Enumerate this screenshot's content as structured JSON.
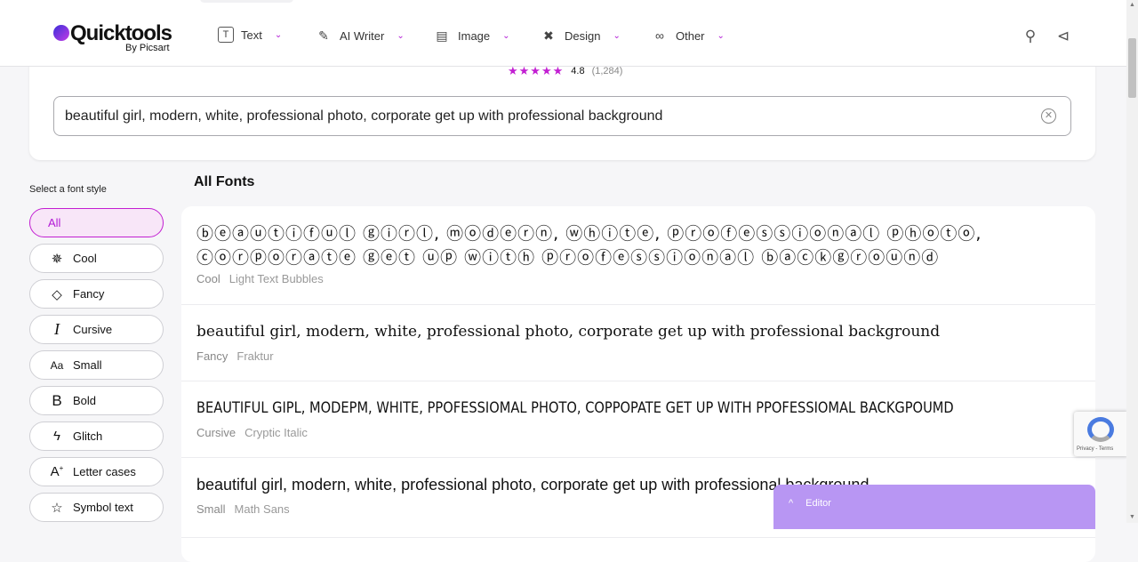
{
  "header": {
    "logo": "Quicktools",
    "logo_sub": "By Picsart",
    "nav": [
      {
        "label": "Text",
        "icon": "text-box-icon"
      },
      {
        "label": "AI Writer",
        "icon": "magic-wand-icon"
      },
      {
        "label": "Image",
        "icon": "image-icon"
      },
      {
        "label": "Design",
        "icon": "design-tools-icon"
      },
      {
        "label": "Other",
        "icon": "shapes-icon"
      }
    ],
    "accent": "#c21fd2"
  },
  "rating": {
    "value": "4.8",
    "count": "(1,284)",
    "stars": 5
  },
  "search": {
    "value": "beautiful girl, modern, white, professional photo, corporate get up with professional background"
  },
  "sidebar": {
    "label": "Select a font style",
    "items": [
      {
        "label": "All",
        "icon": ""
      },
      {
        "label": "Cool",
        "icon": "sparkle-icon"
      },
      {
        "label": "Fancy",
        "icon": "diamond-icon"
      },
      {
        "label": "Cursive",
        "icon": "cursor-i-icon"
      },
      {
        "label": "Small",
        "icon": "aa-icon"
      },
      {
        "label": "Bold",
        "icon": "bold-b-icon"
      },
      {
        "label": "Glitch",
        "icon": "lightning-icon"
      },
      {
        "label": "Letter cases",
        "icon": "letter-case-icon"
      },
      {
        "label": "Symbol text",
        "icon": "star-icon"
      }
    ]
  },
  "main": {
    "title": "All Fonts",
    "fonts": [
      {
        "sample": "ⓑⓔⓐⓤⓣⓘⓕⓤⓛ ⓖⓘⓡⓛ, ⓜⓞⓓⓔⓡⓝ, ⓦⓗⓘⓣⓔ, ⓟⓡⓞⓕⓔⓢⓢⓘⓞⓝⓐⓛ ⓟⓗⓞⓣⓞ, ⓒⓞⓡⓟⓞⓡⓐⓣⓔ ⓖⓔⓣ ⓤⓟ ⓦⓘⓣⓗ ⓟⓡⓞⓕⓔⓢⓢⓘⓞⓝⓐⓛ ⓑⓐⓒⓚⓖⓡⓞⓤⓝⓓ",
        "category": "Cool",
        "name": "Light Text Bubbles"
      },
      {
        "sample": "beautiful girl, modern, white, professional photo, corporate get up with professional background",
        "category": "Fancy",
        "name": "Fraktur"
      },
      {
        "sample": "BEAUTIFUL GIPL, MODEPM, WHITE, PPOFESSIOMAL PHOTO, COPPOPATE GET UP WITH PPOFESSIOMAL BACKGPOUMD",
        "category": "Cursive",
        "name": "Cryptic Italic"
      },
      {
        "sample": "beautiful girl, modern, white, professional photo, corporate get up with professional background",
        "category": "Small",
        "name": "Math Sans"
      }
    ]
  },
  "editor": {
    "label": "Editor"
  },
  "recaptcha": {
    "text": "Privacy - Terms"
  }
}
